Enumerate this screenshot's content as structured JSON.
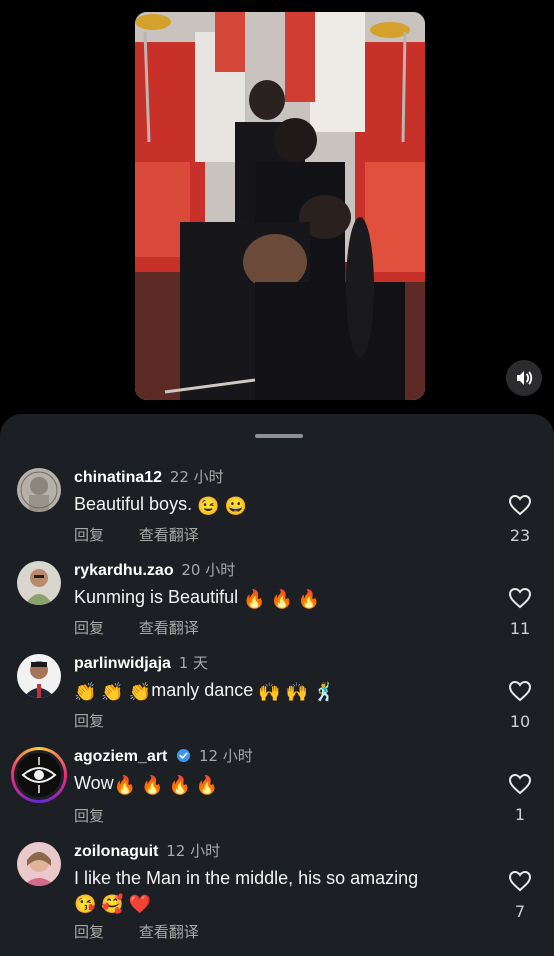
{
  "colors": {
    "sheet_background": "#1c1f24",
    "secondary_text": "#a8a8a8",
    "verified_badge": "#3897f0"
  },
  "video": {
    "mute_icon": "speaker-icon"
  },
  "comments": [
    {
      "username": "chinatina12",
      "time": "22 小时",
      "text": "Beautiful boys.",
      "emojis": "😉 😀",
      "reply_label": "回复",
      "translate_label": "查看翻译",
      "likes": "23",
      "verified": false
    },
    {
      "username": "rykardhu.zao",
      "time": "20 小时",
      "text": "Kunming is Beautiful",
      "emojis": "🔥 🔥 🔥",
      "reply_label": "回复",
      "translate_label": "查看翻译",
      "likes": "11",
      "verified": false
    },
    {
      "username": "parlinwidjaja",
      "time": "1 天",
      "prefix_emojis": "👏 👏 👏",
      "text": "manly dance",
      "emojis": "🙌 🙌 🕺",
      "reply_label": "回复",
      "likes": "10",
      "verified": false
    },
    {
      "username": "agoziem_art",
      "time": "12 小时",
      "text": "Wow",
      "emojis": "🔥 🔥 🔥 🔥",
      "reply_label": "回复",
      "likes": "1",
      "verified": true
    },
    {
      "username": "zoilonaguit",
      "time": "12 小时",
      "text": "I like the Man in the middle, his so amazing",
      "emojis": "😘 🥰 ❤️",
      "reply_label": "回复",
      "translate_label": "查看翻译",
      "likes": "7",
      "verified": false
    }
  ]
}
